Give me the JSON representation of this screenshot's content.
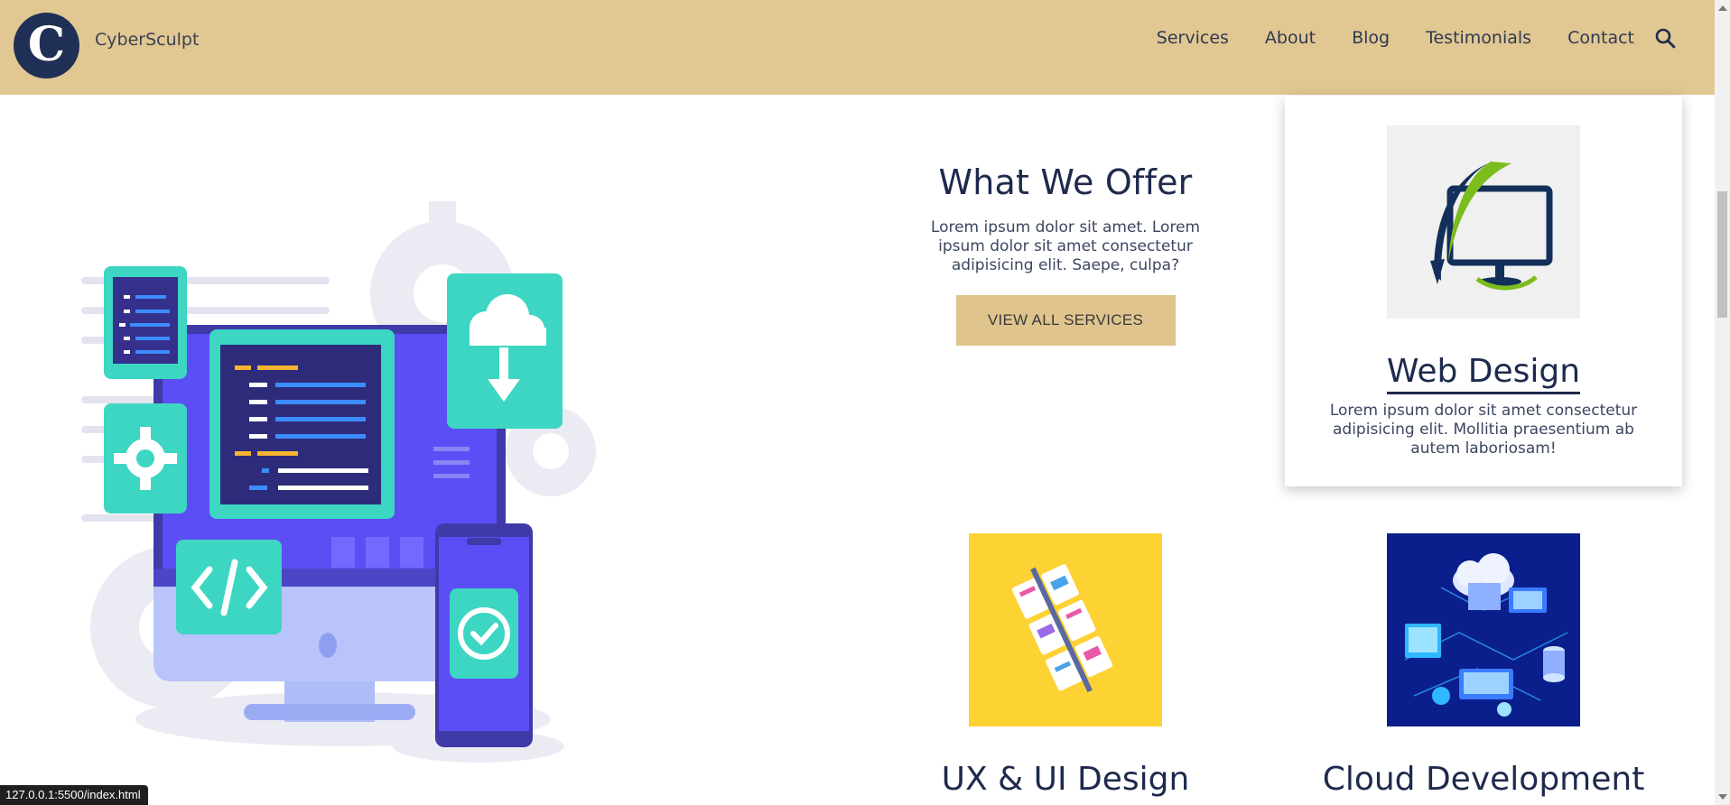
{
  "header": {
    "logo_letter": "C",
    "brand": "CyberSculpt",
    "nav": [
      "Services",
      "About",
      "Blog",
      "Testimonials",
      "Contact"
    ],
    "search_icon": "search-icon"
  },
  "offer": {
    "title": "What We Offer",
    "text": "Lorem ipsum dolor sit amet. Lorem ipsum dolor sit amet consectetur adipisicing elit. Saepe, culpa?",
    "button": "VIEW ALL SERVICES"
  },
  "services": [
    {
      "title": "Web Design",
      "text": "Lorem ipsum dolor sit amet consectetur adipisicing elit. Mollitia praesentium ab autem laboriosam!"
    },
    {
      "title": "UX & UI Design"
    },
    {
      "title": "Cloud Development"
    }
  ],
  "status_bar": "127.0.0.1:5500/index.html",
  "colors": {
    "header_bg": "#e1c792",
    "button_bg": "#e0c48e",
    "navy": "#1e2a4d",
    "ux_bg": "#fdd233",
    "cloud_bg": "#0b1f8c"
  }
}
